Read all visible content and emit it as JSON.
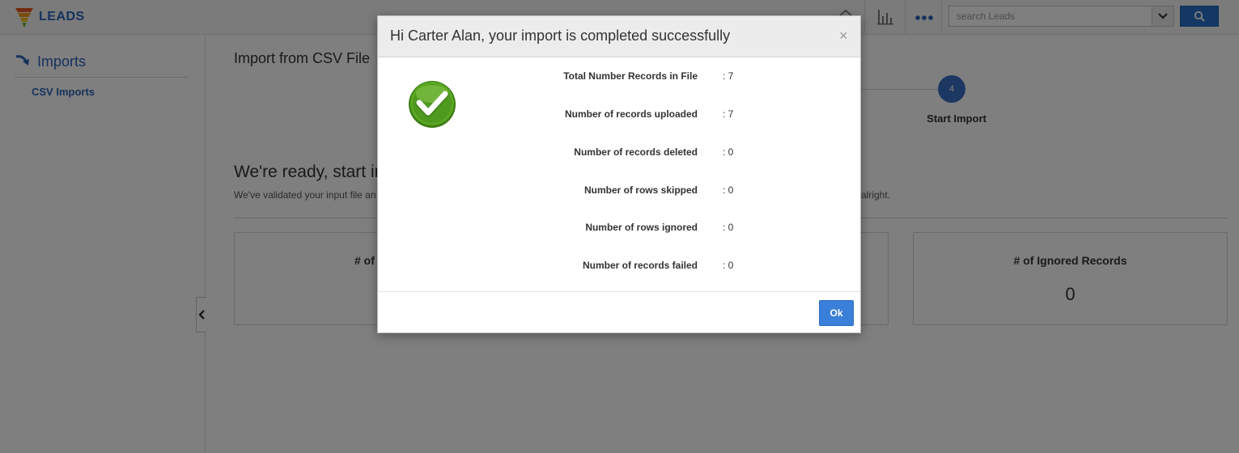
{
  "header": {
    "app_name": "LEADS",
    "icons": [
      "home-icon",
      "bar-chart-icon",
      "more-icon"
    ],
    "search_placeholder": "search Leads",
    "accent_color": "#2a64b8"
  },
  "sidebar": {
    "section_title": "Imports",
    "items": [
      {
        "label": "CSV Imports"
      }
    ]
  },
  "main": {
    "page_title": "Import from CSV File",
    "step": {
      "number": "4",
      "label": "Start Import"
    },
    "ready_heading": "We're ready, start in",
    "ready_text": "We've validated your input file an",
    "ready_text_tail": "alright.",
    "cards": [
      {
        "title": "# of",
        "value": ""
      },
      {
        "title": "# of Ignored Records",
        "value": "0"
      }
    ]
  },
  "modal": {
    "title": "Hi Carter Alan, your import is completed successfully",
    "close_label": "×",
    "rows": [
      {
        "label": "Total Number Records in File",
        "value": ": 7"
      },
      {
        "label": "Number of records uploaded",
        "value": ": 7"
      },
      {
        "label": "Number of records deleted",
        "value": ": 0"
      },
      {
        "label": "Number of rows skipped",
        "value": ": 0"
      },
      {
        "label": "Number of rows ignored",
        "value": ": 0"
      },
      {
        "label": "Number of records failed",
        "value": ": 0"
      }
    ],
    "ok_label": "Ok",
    "success_color": "#4e9a1f"
  }
}
